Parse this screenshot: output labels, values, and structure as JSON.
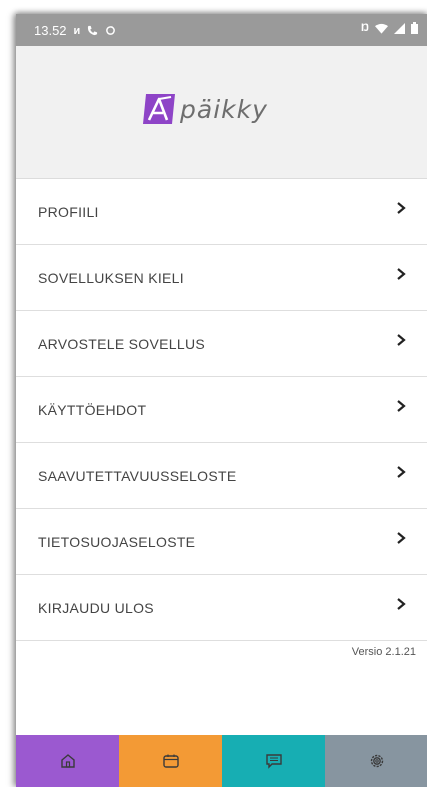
{
  "status_bar": {
    "time": "13.52",
    "icons_left": [
      "notification-icon",
      "phone-icon",
      "sync-icon"
    ],
    "icons_right": [
      "nfc-icon",
      "wifi-icon",
      "signal-icon",
      "battery-icon"
    ]
  },
  "brand": {
    "name": "päikky",
    "accent_color": "#8e44c7"
  },
  "menu": {
    "items": [
      {
        "label": "PROFIILI"
      },
      {
        "label": "SOVELLUKSEN KIELI"
      },
      {
        "label": "ARVOSTELE SOVELLUS"
      },
      {
        "label": "KÄYTTÖEHDOT"
      },
      {
        "label": "SAAVUTETTAVUUSSELOSTE"
      },
      {
        "label": "TIETOSUOJASELOSTE"
      },
      {
        "label": "KIRJAUDU ULOS"
      }
    ]
  },
  "version": "Versio 2.1.21",
  "bottom_nav": {
    "tabs": [
      {
        "icon": "home-icon",
        "color": "#9b59d0"
      },
      {
        "icon": "calendar-icon",
        "color": "#f39a35"
      },
      {
        "icon": "message-icon",
        "color": "#17aeb3"
      },
      {
        "icon": "gear-icon",
        "color": "#8795a0"
      }
    ]
  }
}
